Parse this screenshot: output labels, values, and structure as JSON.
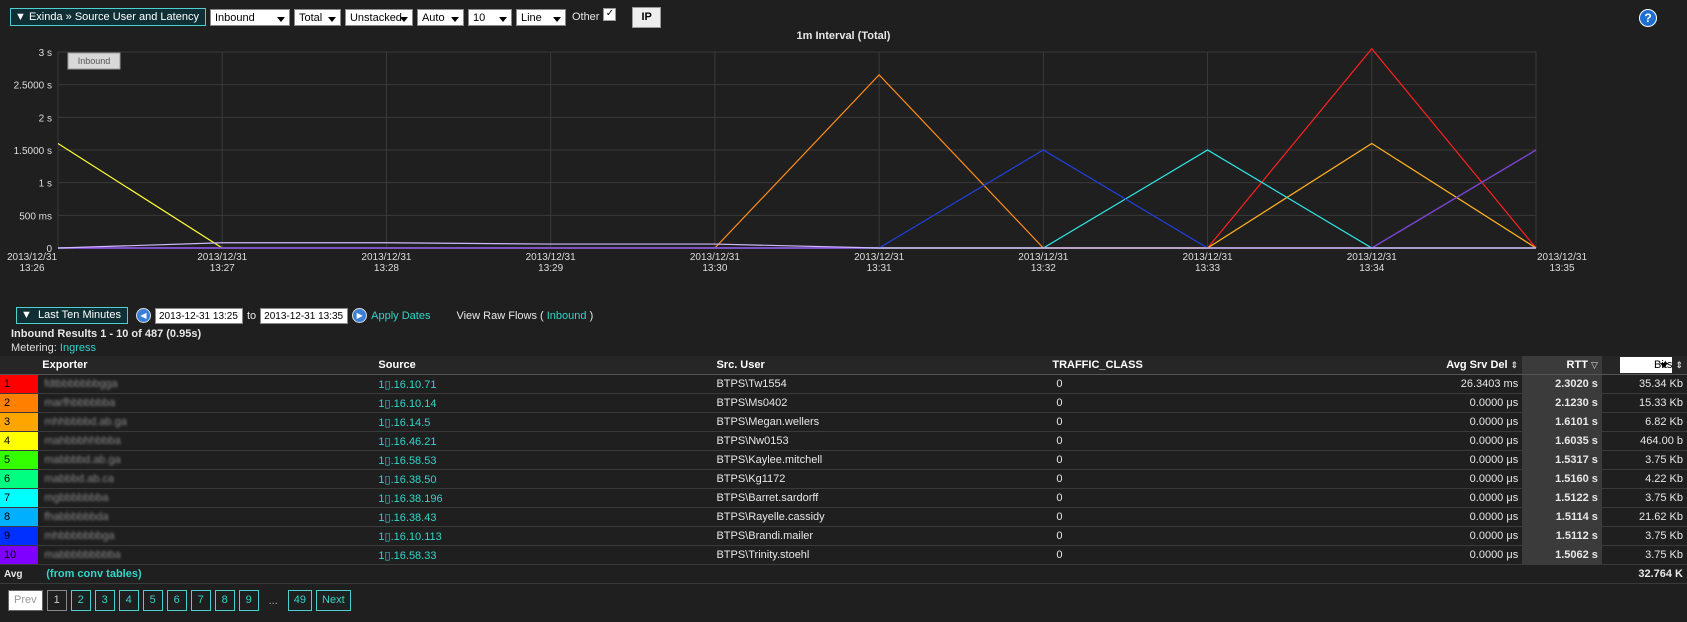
{
  "toolbar": {
    "title": "Exinda » Source User and Latency",
    "selects": [
      "Inbound",
      "Total",
      "Unstacked",
      "Auto",
      "10",
      "Line"
    ],
    "other_label": "Other",
    "other_checked": "✓",
    "ip_label": "IP"
  },
  "chart": {
    "title": "1m Interval (Total)",
    "legend_button": "Inbound",
    "y_ticks": [
      "3 s",
      "2.5000 s",
      "2 s",
      "1.5000 s",
      "1 s",
      "500 ms",
      "0"
    ],
    "x_ticks": [
      [
        "2013/12/31",
        "13:26"
      ],
      [
        "2013/12/31",
        "13:27"
      ],
      [
        "2013/12/31",
        "13:28"
      ],
      [
        "2013/12/31",
        "13:29"
      ],
      [
        "2013/12/31",
        "13:30"
      ],
      [
        "2013/12/31",
        "13:31"
      ],
      [
        "2013/12/31",
        "13:32"
      ],
      [
        "2013/12/31",
        "13:33"
      ],
      [
        "2013/12/31",
        "13:34"
      ],
      [
        "2013/12/31",
        "13:35"
      ]
    ]
  },
  "chart_data": {
    "type": "line",
    "x": [
      "13:26",
      "13:27",
      "13:28",
      "13:29",
      "13:30",
      "13:31",
      "13:32",
      "13:33",
      "13:34",
      "13:35"
    ],
    "ylim": [
      0,
      3
    ],
    "ylabel": "",
    "series": [
      {
        "color": "#ff2020",
        "values": [
          0,
          0,
          0,
          0,
          0,
          0,
          0,
          0,
          3.05,
          0
        ]
      },
      {
        "color": "#ff8c1a",
        "values": [
          0,
          0,
          0,
          0,
          0,
          2.65,
          0,
          0,
          0,
          0
        ]
      },
      {
        "color": "#ffb020",
        "values": [
          0,
          0,
          0,
          0,
          0,
          0,
          0,
          0,
          1.6,
          0
        ]
      },
      {
        "color": "#ffff30",
        "values": [
          1.6,
          0,
          0,
          0,
          0,
          0,
          0,
          0,
          0,
          0
        ]
      },
      {
        "color": "#33ee33",
        "values": [
          0,
          0,
          0,
          0,
          0,
          0,
          0,
          0,
          0,
          1.5
        ]
      },
      {
        "color": "#30e8e8",
        "values": [
          0,
          0,
          0,
          0,
          0,
          0,
          0,
          1.5,
          0,
          0
        ]
      },
      {
        "color": "#2040e0",
        "values": [
          0,
          0,
          0,
          0,
          0,
          0,
          1.5,
          0,
          0,
          0
        ]
      },
      {
        "color": "#8a30f0",
        "values": [
          0,
          0,
          0,
          0,
          0,
          0,
          0,
          0,
          0,
          1.5
        ]
      },
      {
        "color": "#d0b8ff",
        "values": [
          0,
          0.08,
          0.08,
          0.06,
          0.06,
          0,
          0,
          0,
          0,
          0
        ]
      }
    ]
  },
  "dates": {
    "range_label": "Last Ten Minutes",
    "from": "2013-12-31 13:25",
    "to_label": "to",
    "to": "2013-12-31 13:35",
    "apply": "Apply Dates",
    "raw_flows_prefix": "View Raw Flows (",
    "raw_flows_link": "Inbound",
    "raw_flows_suffix": ")"
  },
  "results": {
    "title": "Inbound Results 1 - 10 of 487 (0.95s)",
    "metering_label": "Metering:",
    "metering_value": "Ingress"
  },
  "table": {
    "headers": {
      "exporter": "Exporter",
      "source": "Source",
      "src_user": "Src. User",
      "traffic_class": "TRAFFIC_CLASS",
      "avg_srv_del": "Avg Srv Del",
      "rtt": "RTT",
      "bits": "Bits"
    },
    "rows": [
      {
        "n": "1",
        "color": "#ff0000",
        "exporter": "fdtbbbbbbbgga",
        "source": "1▯.16.10.71",
        "user": "BTPS\\Tw1554",
        "tc": "0",
        "del": "26.3403 ms",
        "rtt": "2.3020 s",
        "bits": "35.34 Kb"
      },
      {
        "n": "2",
        "color": "#ff8000",
        "exporter": "marfhbbbbbba",
        "source": "1▯.16.10.14",
        "user": "BTPS\\Ms0402",
        "tc": "0",
        "del": "0.0000 μs",
        "rtt": "2.1230 s",
        "bits": "15.33 Kb"
      },
      {
        "n": "3",
        "color": "#ffa500",
        "exporter": "mhhbbbbd.ab.ga",
        "source": "1▯.16.14.5",
        "user": "BTPS\\Megan.wellers",
        "tc": "0",
        "del": "0.0000 μs",
        "rtt": "1.6101 s",
        "bits": "6.82 Kb"
      },
      {
        "n": "4",
        "color": "#ffff00",
        "exporter": "mahbbbhhbbba",
        "source": "1▯.16.46.21",
        "user": "BTPS\\Nw0153",
        "tc": "0",
        "del": "0.0000 μs",
        "rtt": "1.6035 s",
        "bits": "464.00 b"
      },
      {
        "n": "5",
        "color": "#33ff00",
        "exporter": "mabbbbd.ab.ga",
        "source": "1▯.16.58.53",
        "user": "BTPS\\Kaylee.mitchell",
        "tc": "0",
        "del": "0.0000 μs",
        "rtt": "1.5317 s",
        "bits": "3.75 Kb"
      },
      {
        "n": "6",
        "color": "#00ff80",
        "exporter": "mabbbd.ab.ca",
        "source": "1▯.16.38.50",
        "user": "BTPS\\Kg1172",
        "tc": "0",
        "del": "0.0000 μs",
        "rtt": "1.5160 s",
        "bits": "4.22 Kb"
      },
      {
        "n": "7",
        "color": "#00ffff",
        "exporter": "mgbbbbbbba",
        "source": "1▯.16.38.196",
        "user": "BTPS\\Barret.sardorff",
        "tc": "0",
        "del": "0.0000 μs",
        "rtt": "1.5122 s",
        "bits": "3.75 Kb"
      },
      {
        "n": "8",
        "color": "#00b0ff",
        "exporter": "fhabbbbbbda",
        "source": "1▯.16.38.43",
        "user": "BTPS\\Rayelle.cassidy",
        "tc": "0",
        "del": "0.0000 μs",
        "rtt": "1.5114 s",
        "bits": "21.62 Kb"
      },
      {
        "n": "9",
        "color": "#0030ff",
        "exporter": "mhbbbbbbbga",
        "source": "1▯.16.10.113",
        "user": "BTPS\\Brandi.mailer",
        "tc": "0",
        "del": "0.0000 μs",
        "rtt": "1.5112 s",
        "bits": "3.75 Kb"
      },
      {
        "n": "10",
        "color": "#8000ff",
        "exporter": "mabbbbbbbbba",
        "source": "1▯.16.58.33",
        "user": "BTPS\\Trinity.stoehl",
        "tc": "0",
        "del": "0.0000 μs",
        "rtt": "1.5062 s",
        "bits": "3.75 Kb"
      }
    ],
    "avg_label": "Avg",
    "avg_note": "(from conv tables)",
    "avg_bits": "32.764 K"
  },
  "pager": {
    "prev": "Prev",
    "pages": [
      "1",
      "2",
      "3",
      "4",
      "5",
      "6",
      "7",
      "8",
      "9"
    ],
    "ellipsis": "...",
    "last": "49",
    "next": "Next"
  }
}
